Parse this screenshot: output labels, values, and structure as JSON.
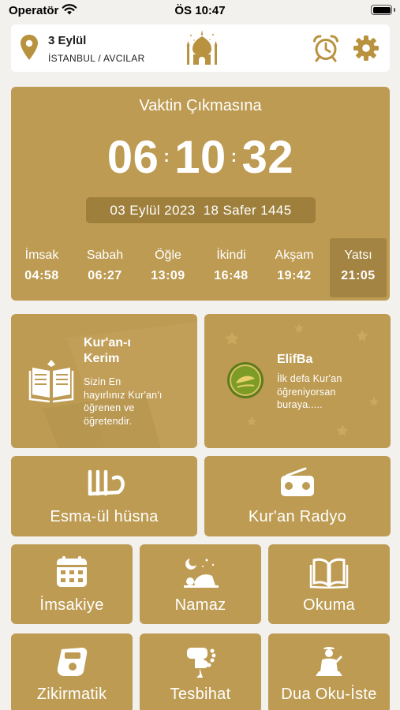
{
  "status_bar": {
    "carrier": "Operatör",
    "time": "ÖS 10:47"
  },
  "header": {
    "date": "3 Eylül",
    "location": "İSTANBUL / AVCILAR",
    "icons": [
      "location-pin-icon",
      "mosque-icon",
      "alarm-clock-icon",
      "gear-icon"
    ]
  },
  "countdown": {
    "title": "Vaktin Çıkmasına",
    "hours": "06",
    "minutes": "10",
    "seconds": "32",
    "gregorian_date": "03 Eylül 2023",
    "hijri_date": "18 Safer 1445"
  },
  "prayer_times": [
    {
      "name": "İmsak",
      "time": "04:58"
    },
    {
      "name": "Sabah",
      "time": "06:27"
    },
    {
      "name": "Öğle",
      "time": "13:09"
    },
    {
      "name": "İkindi",
      "time": "16:48"
    },
    {
      "name": "Akşam",
      "time": "19:42"
    },
    {
      "name": "Yatsı",
      "time": "21:05",
      "active": true
    }
  ],
  "feature_cards": {
    "quran": {
      "title_line1": "Kur'an-ı",
      "title_line2": "Kerim",
      "desc_line1": "Sizin En",
      "desc_line2": "hayırlınız Kur'an'ı",
      "desc_line3": "öğrenen ve",
      "desc_line4": "öğretendir."
    },
    "elifba": {
      "title": "ElifBa",
      "desc_line1": "İlk defa Kur'an",
      "desc_line2": "öğreniyorsan",
      "desc_line3": "buraya....."
    }
  },
  "menu": {
    "esma": "Esma-ül hüsna",
    "radio": "Kur'an Radyo",
    "imsakiye": "İmsakiye",
    "namaz": "Namaz",
    "okuma": "Okuma",
    "zikirmatik": "Zikirmatik",
    "tesbihat": "Tesbihat",
    "dua": "Dua Oku-İste"
  },
  "colors": {
    "card_gold": "#bd9b52",
    "pill_gold": "#9f7f3c",
    "active_prayer": "#a48443",
    "icon_gold": "#b8923f",
    "background": "#f3f1ee"
  }
}
